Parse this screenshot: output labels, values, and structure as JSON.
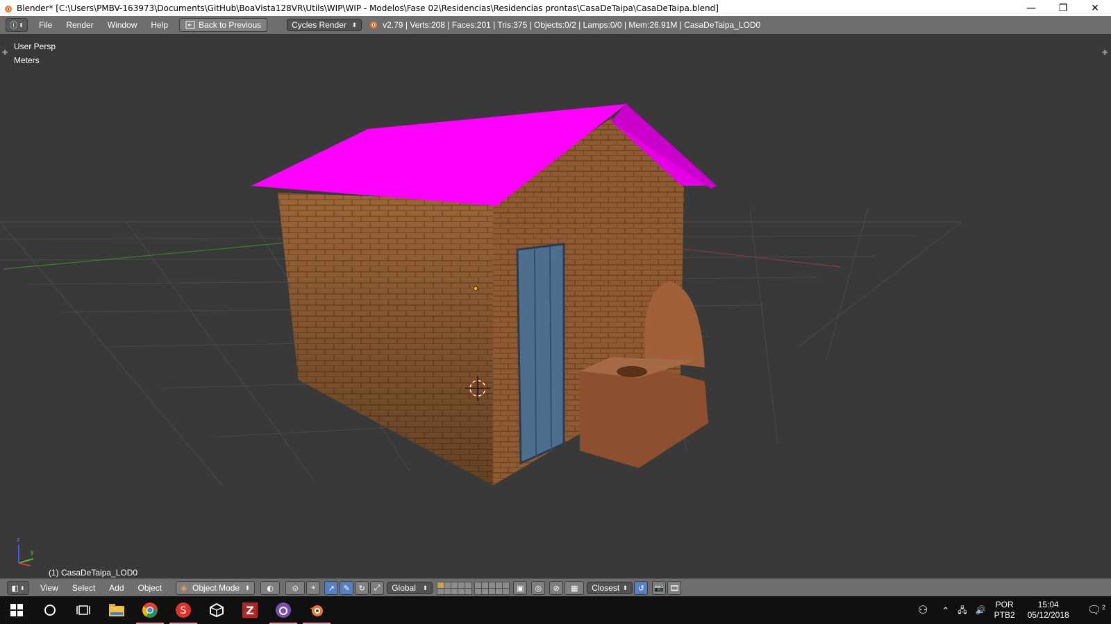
{
  "window": {
    "title": "Blender* [C:\\Users\\PMBV-163973\\Documents\\GitHub\\BoaVista128VR\\Utils\\WIP\\WIP - Modelos\\Fase 02\\Residencias\\Residencias prontas\\CasaDeTaipa\\CasaDeTaipa.blend]",
    "controls": {
      "minimize": "—",
      "restore": "❐",
      "close": "✕"
    }
  },
  "info_header": {
    "editor_icon": "info-icon",
    "menus": [
      "File",
      "Render",
      "Window",
      "Help"
    ],
    "back_button": "Back to Previous",
    "render_engine": "Cycles Render",
    "stats": "v2.79 | Verts:208 | Faces:201 | Tris:375 | Objects:0/2 | Lamps:0/0 | Mem:26.91M | CasaDeTaipa_LOD0"
  },
  "viewport": {
    "view_name": "User Persp",
    "units": "Meters",
    "object_label": "(1) CasaDeTaipa_LOD0",
    "axis_labels": {
      "z": "z",
      "y": "y"
    },
    "roof_color": "#ff00ff",
    "wall_color": "#9a6438",
    "door_color": "#4d6e8f"
  },
  "view_header": {
    "menus": [
      "View",
      "Select",
      "Add",
      "Object"
    ],
    "mode": "Object Mode",
    "orientation": "Global",
    "snap_target": "Closest"
  },
  "taskbar": {
    "apps": [
      "start-icon",
      "search-icon",
      "task-view-icon",
      "file-explorer-icon",
      "chrome-icon",
      "substance-icon",
      "unity-icon",
      "filezilla-icon",
      "tor-icon",
      "blender-icon"
    ],
    "language": "POR",
    "keyboard": "PTB2",
    "time": "15:04",
    "date": "05/12/2018",
    "notifications": "2"
  }
}
